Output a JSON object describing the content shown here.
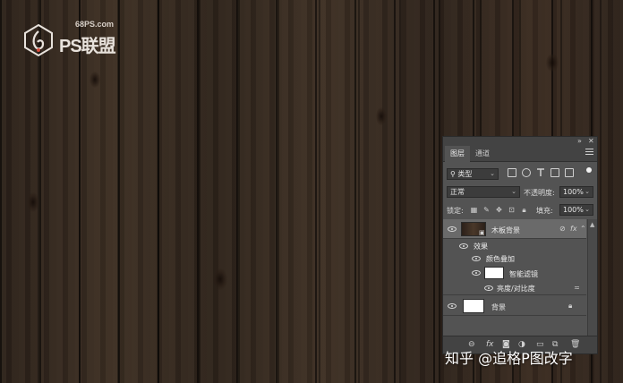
{
  "logo": {
    "site": "68PS.com",
    "text": "PS联盟"
  },
  "watermark": "知乎 @追格P图改字",
  "panel": {
    "collapse_btn": "»",
    "close_btn": "✕",
    "tabs": [
      {
        "label": "图层",
        "active": true
      },
      {
        "label": "通道",
        "active": false
      }
    ],
    "filter": {
      "search_glyph": "⚲",
      "kind_label": "类型"
    },
    "blend": {
      "mode": "正常",
      "opacity_label": "不透明度:",
      "opacity_value": "100%"
    },
    "lock": {
      "label": "锁定:",
      "fill_label": "填充:",
      "fill_value": "100%"
    },
    "layers": [
      {
        "name": "木板背景",
        "selected": true,
        "fx": "fx"
      },
      {
        "name": "效果"
      },
      {
        "name": "颜色叠加"
      },
      {
        "name": "智能滤镜"
      },
      {
        "name": "亮度/对比度"
      },
      {
        "name": "背景"
      }
    ],
    "bottom_icons": [
      "link",
      "fx",
      "mask",
      "adjust",
      "folder",
      "new",
      "trash"
    ]
  },
  "colors": {
    "panel_bg": "#535353",
    "panel_dark": "#434343",
    "selected_layer": "#6a6a6a"
  }
}
